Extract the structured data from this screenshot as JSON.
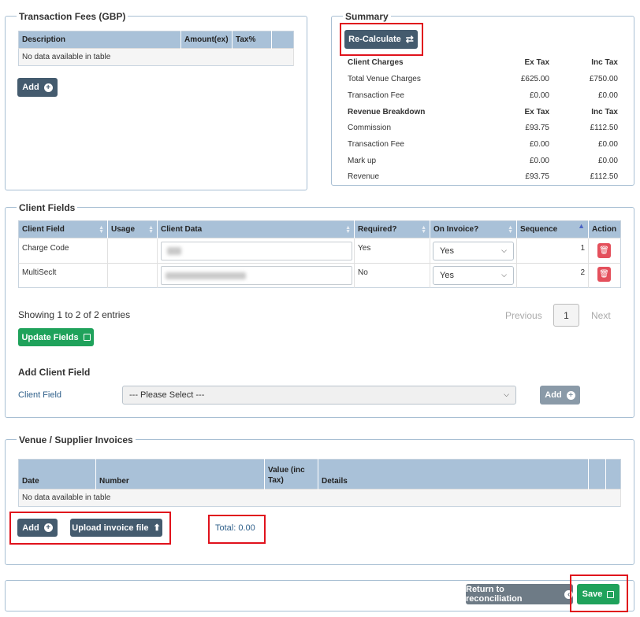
{
  "transaction_fees": {
    "legend": "Transaction Fees (GBP)",
    "columns": [
      "Description",
      "Amount(ex)",
      "Tax%"
    ],
    "empty": "No data available in table",
    "add_label": "Add"
  },
  "summary": {
    "legend": "Summary",
    "recalc_label": "Re-Calculate",
    "client_charges": {
      "heading": "Client Charges",
      "ex_header": "Ex Tax",
      "inc_header": "Inc Tax",
      "rows": [
        {
          "label": "Total Venue Charges",
          "ex": "£625.00",
          "inc": "£750.00"
        },
        {
          "label": "Transaction Fee",
          "ex": "£0.00",
          "inc": "£0.00"
        }
      ]
    },
    "revenue": {
      "heading": "Revenue Breakdown",
      "ex_header": "Ex Tax",
      "inc_header": "Inc Tax",
      "rows": [
        {
          "label": "Commission",
          "ex": "£93.75",
          "inc": "£112.50"
        },
        {
          "label": "Transaction Fee",
          "ex": "£0.00",
          "inc": "£0.00"
        },
        {
          "label": "Mark up",
          "ex": "£0.00",
          "inc": "£0.00"
        },
        {
          "label": "Revenue",
          "ex": "£93.75",
          "inc": "£112.50"
        }
      ]
    }
  },
  "client_fields": {
    "legend": "Client Fields",
    "columns": [
      "Client Field",
      "Usage",
      "Client Data",
      "Required?",
      "On Invoice?",
      "Sequence",
      "Action"
    ],
    "rows": [
      {
        "field": "Charge Code",
        "required": "Yes",
        "on_invoice": "Yes",
        "sequence": "1"
      },
      {
        "field": "MultiSeclt",
        "required": "No",
        "on_invoice": "Yes",
        "sequence": "2"
      }
    ],
    "showing": "Showing 1 to 2 of 2 entries",
    "previous": "Previous",
    "page": "1",
    "next": "Next",
    "update_label": "Update Fields",
    "add_heading": "Add Client Field",
    "field_label": "Client Field",
    "select_value": "--- Please Select ---",
    "add_label": "Add"
  },
  "invoices": {
    "legend": "Venue / Supplier Invoices",
    "columns": [
      "Date",
      "Number",
      "Value (inc Tax)",
      "Details"
    ],
    "empty": "No data available in table",
    "add_label": "Add",
    "upload_label": "Upload invoice file",
    "total": "Total: 0.00"
  },
  "footer": {
    "return_label": "Return to reconciliation",
    "save_label": "Save"
  },
  "colors": {
    "header_bg": "#a9c1d8",
    "dark_button": "#445b6e",
    "green_button": "#1fa25b",
    "highlight": "#e0121c",
    "delete_button": "#e4505c"
  }
}
